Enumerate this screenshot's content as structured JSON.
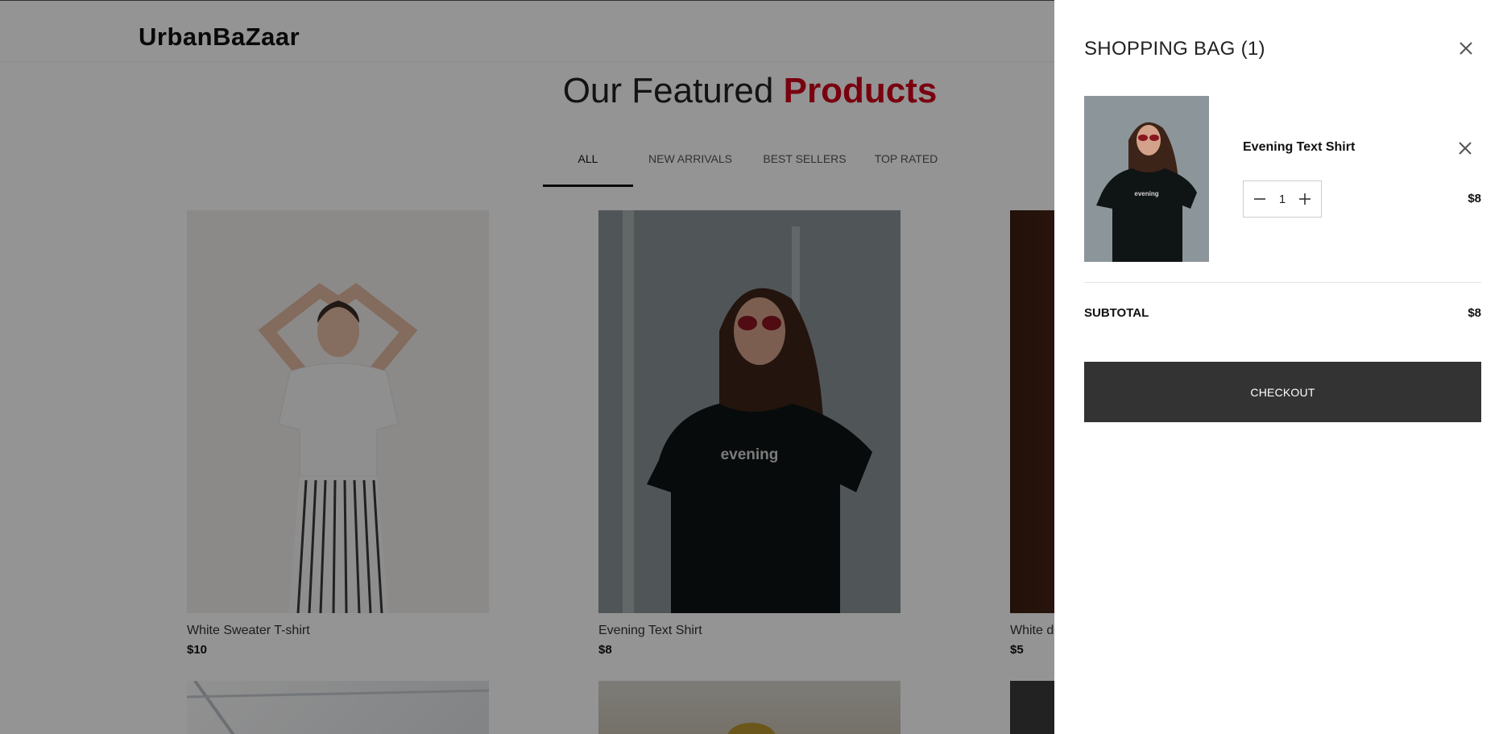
{
  "header": {
    "logo": "UrbanBaZaar"
  },
  "featured": {
    "title_plain": "Our Featured ",
    "title_accent": "Products"
  },
  "tabs": [
    {
      "label": "ALL",
      "active": true
    },
    {
      "label": "NEW ARRIVALS",
      "active": false
    },
    {
      "label": "BEST SELLERS",
      "active": false
    },
    {
      "label": "TOP RATED",
      "active": false
    }
  ],
  "products": [
    {
      "name": "White Sweater T-shirt",
      "price": "$10"
    },
    {
      "name": "Evening Text Shirt",
      "price": "$8"
    },
    {
      "name": "White dr",
      "price": "$5"
    }
  ],
  "cart": {
    "title": "SHOPPING BAG (1)",
    "items": [
      {
        "name": "Evening Text Shirt",
        "quantity": "1",
        "price": "$8",
        "shirt_text": "evening"
      }
    ],
    "subtotal_label": "SUBTOTAL",
    "subtotal_value": "$8",
    "checkout_label": "CHECKOUT"
  },
  "colors": {
    "accent": "#d0021b",
    "checkout_bg": "#333333"
  },
  "icons": [
    "close-icon",
    "minus-icon",
    "plus-icon"
  ]
}
